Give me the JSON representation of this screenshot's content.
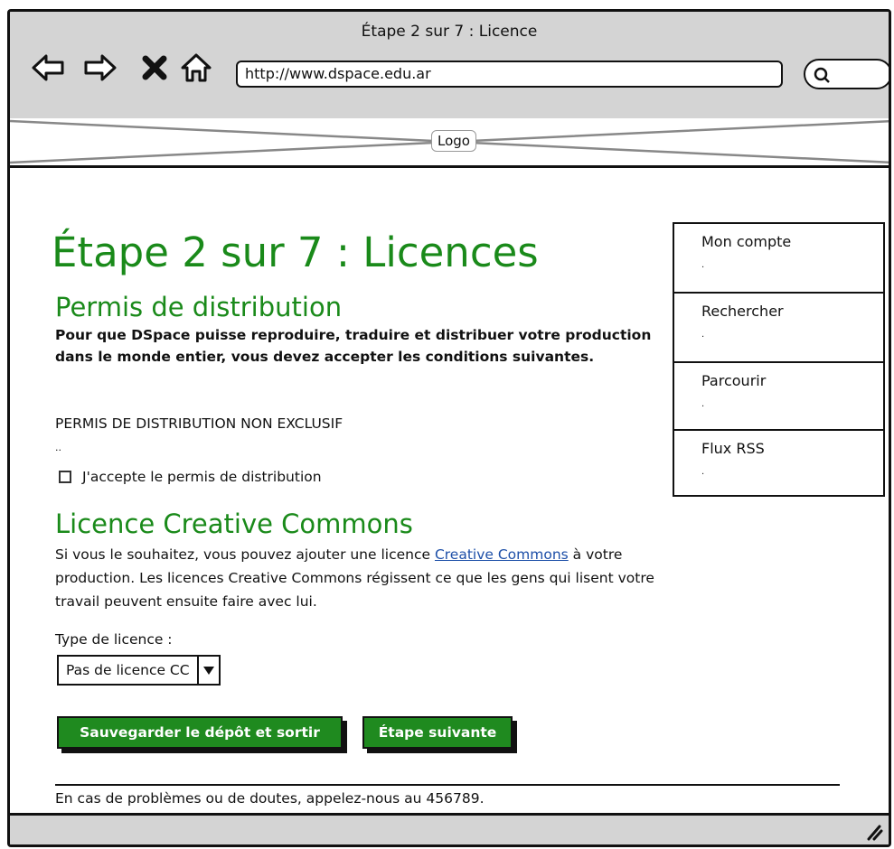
{
  "window": {
    "title": "Étape 2 sur 7 : Licence"
  },
  "browser": {
    "url": "http://www.dspace.edu.ar"
  },
  "header": {
    "logo_label": "Logo"
  },
  "main": {
    "heading": "Étape 2 sur 7 : Licences",
    "distribution": {
      "title": "Permis de distribution",
      "intro": "Pour que DSpace puisse reproduire, traduire et distribuer votre production dans le monde entier, vous devez accepter les conditions suivantes.",
      "license_name": "PERMIS DE DISTRIBUTION NON EXCLUSIF",
      "ellipsis": "..",
      "accept_label": "J'accepte le permis de distribution"
    },
    "creative_commons": {
      "title": "Licence Creative Commons",
      "para_before": "Si vous le souhaitez, vous pouvez ajouter une licence ",
      "link_text": "Creative Commons",
      "para_after": " à votre production. Les licences Creative Commons régissent ce que les gens qui lisent votre travail peuvent ensuite faire avec lui.",
      "type_label": "Type de licence :",
      "selected_type": "Pas de licence CC"
    },
    "buttons": {
      "save_exit": "Sauvegarder le dépôt et sortir",
      "next_step": "Étape suivante"
    },
    "footer_text": "En cas de problèmes ou de doutes, appelez-nous au 456789."
  },
  "sidebar": {
    "items": [
      {
        "label": "Mon compte",
        "sub": "."
      },
      {
        "label": "Rechercher",
        "sub": "."
      },
      {
        "label": "Parcourir",
        "sub": "."
      },
      {
        "label": "Flux RSS",
        "sub": "."
      }
    ]
  },
  "colors": {
    "accent": "#1f8a1f",
    "heading": "#1a8a1a",
    "link": "#1d4fa8",
    "chrome": "#d4d4d4"
  }
}
